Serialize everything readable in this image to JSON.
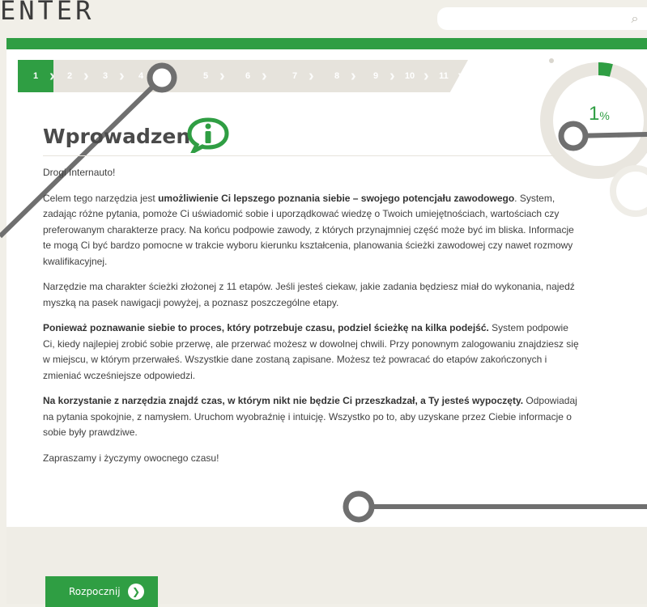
{
  "header": {
    "logo_text": "ENTER",
    "search_placeholder": "",
    "search_icon": "magnifier-icon"
  },
  "steps": [
    {
      "label": "1",
      "active": true
    },
    {
      "label": "2"
    },
    {
      "label": "3"
    },
    {
      "label": "4"
    },
    {
      "label": "5"
    },
    {
      "label": "6"
    },
    {
      "label": "7"
    },
    {
      "label": "8"
    },
    {
      "label": "9"
    },
    {
      "label": "10"
    },
    {
      "label": "11"
    }
  ],
  "progress": {
    "value": "1",
    "unit": "%",
    "fraction": 0.01
  },
  "page": {
    "title": "Wprowadzenie",
    "title_icon": "info-speech-bubble-icon"
  },
  "content": {
    "greeting": "Drogi Internauto!",
    "p1_prefix": "Celem tego narzędzia jest ",
    "p1_bold": "umożliwienie Ci lepszego poznania siebie – swojego potencjału zawodowego",
    "p1_rest": ". System, zadając różne pytania, pomoże Ci uświadomić sobie i uporządkować wiedzę o Twoich umiejętnościach, wartościach czy preferowanym charakterze pracy. Na końcu podpowie zawody, z których przynajmniej część może być im bliska. Informacje te mogą Ci być bardzo pomocne w trakcie wyboru kierunku kształcenia, planowania ścieżki zawodowej czy nawet rozmowy kwalifikacyjnej.",
    "p2": "Narzędzie ma charakter ścieżki złożonej z 11 etapów. Jeśli jesteś ciekaw, jakie zadania będziesz miał do wykonania, najedź myszką na pasek nawigacji powyżej, a poznasz poszczególne etapy.",
    "p3_bold": "Ponieważ poznawanie siebie to proces, który potrzebuje czasu, podziel ścieżkę na kilka podejść.",
    "p3_rest": " System podpowie Ci, kiedy najlepiej zrobić sobie przerwę, ale przerwać możesz w dowolnej chwili. Przy ponownym zalogowaniu znajdziesz się w miejscu, w którym przerwałeś. Wszystkie dane zostaną zapisane. Możesz też powracać do etapów zakończonych i zmieniać wcześniejsze odpowiedzi.",
    "p4_bold": "Na korzystanie z narzędzia znajdź czas, w którym nikt nie będzie Ci przeszkadzał, a Ty jesteś wypoczęty.",
    "p4_rest": " Odpowiadaj na pytania spokojnie, z namysłem. Uruchom wyobraźnię i intuicję. Wszystko po to, aby uzyskane przez Ciebie informacje o sobie były prawdziwe.",
    "closing": "Zapraszamy i życzymy owocnego czasu!"
  },
  "actions": {
    "start_label": "Rozpocznij",
    "start_icon": "arrow-right-circle-icon"
  },
  "colors": {
    "accent": "#2f9e43",
    "background": "#f1efe8",
    "text": "#404040",
    "deco_line": "#6f6f6f"
  }
}
